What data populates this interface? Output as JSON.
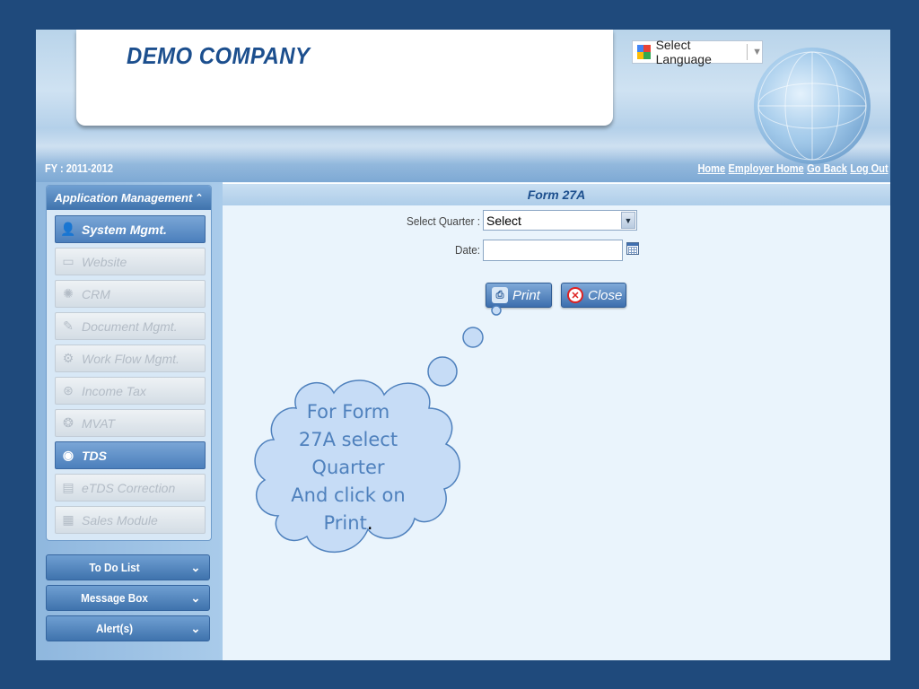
{
  "header": {
    "company_name": "DEMO COMPANY",
    "language_selector": "Select Language",
    "fiscal_year": "FY : 2011-2012",
    "links": [
      "Home",
      "Employer Home",
      "Go Back",
      "Log Out"
    ]
  },
  "sidebar": {
    "panel_title": "Application Management",
    "modules": [
      {
        "label": "System Mgmt.",
        "icon": "user-icon",
        "active": true
      },
      {
        "label": "Website",
        "icon": "website-icon",
        "active": false
      },
      {
        "label": "CRM",
        "icon": "crm-icon",
        "active": false
      },
      {
        "label": "Document Mgmt.",
        "icon": "document-icon",
        "active": false
      },
      {
        "label": "Work Flow Mgmt.",
        "icon": "workflow-icon",
        "active": false
      },
      {
        "label": "Income Tax",
        "icon": "income-tax-icon",
        "active": false
      },
      {
        "label": "MVAT",
        "icon": "mvat-icon",
        "active": false
      },
      {
        "label": "TDS",
        "icon": "tds-icon",
        "active": true
      },
      {
        "label": "eTDS Correction",
        "icon": "etds-icon",
        "active": false
      },
      {
        "label": "Sales Module",
        "icon": "sales-icon",
        "active": false
      }
    ],
    "accordions": [
      "To Do List",
      "Message Box",
      "Alert(s)"
    ]
  },
  "form": {
    "title": "Form 27A",
    "quarter_label": "Select Quarter :",
    "quarter_value": "Select",
    "date_label": "Date:",
    "date_value": "",
    "print_label": "Print",
    "close_label": "Close"
  },
  "callout": {
    "lines": [
      "For Form",
      "27A select",
      "Quarter",
      "And click on",
      "Print"
    ],
    "trailing": "."
  },
  "colors": {
    "background": "#1f4a7c",
    "accent": "#3f73ad",
    "callout_fill": "#c6dcf6",
    "callout_text": "#4f81bd"
  }
}
